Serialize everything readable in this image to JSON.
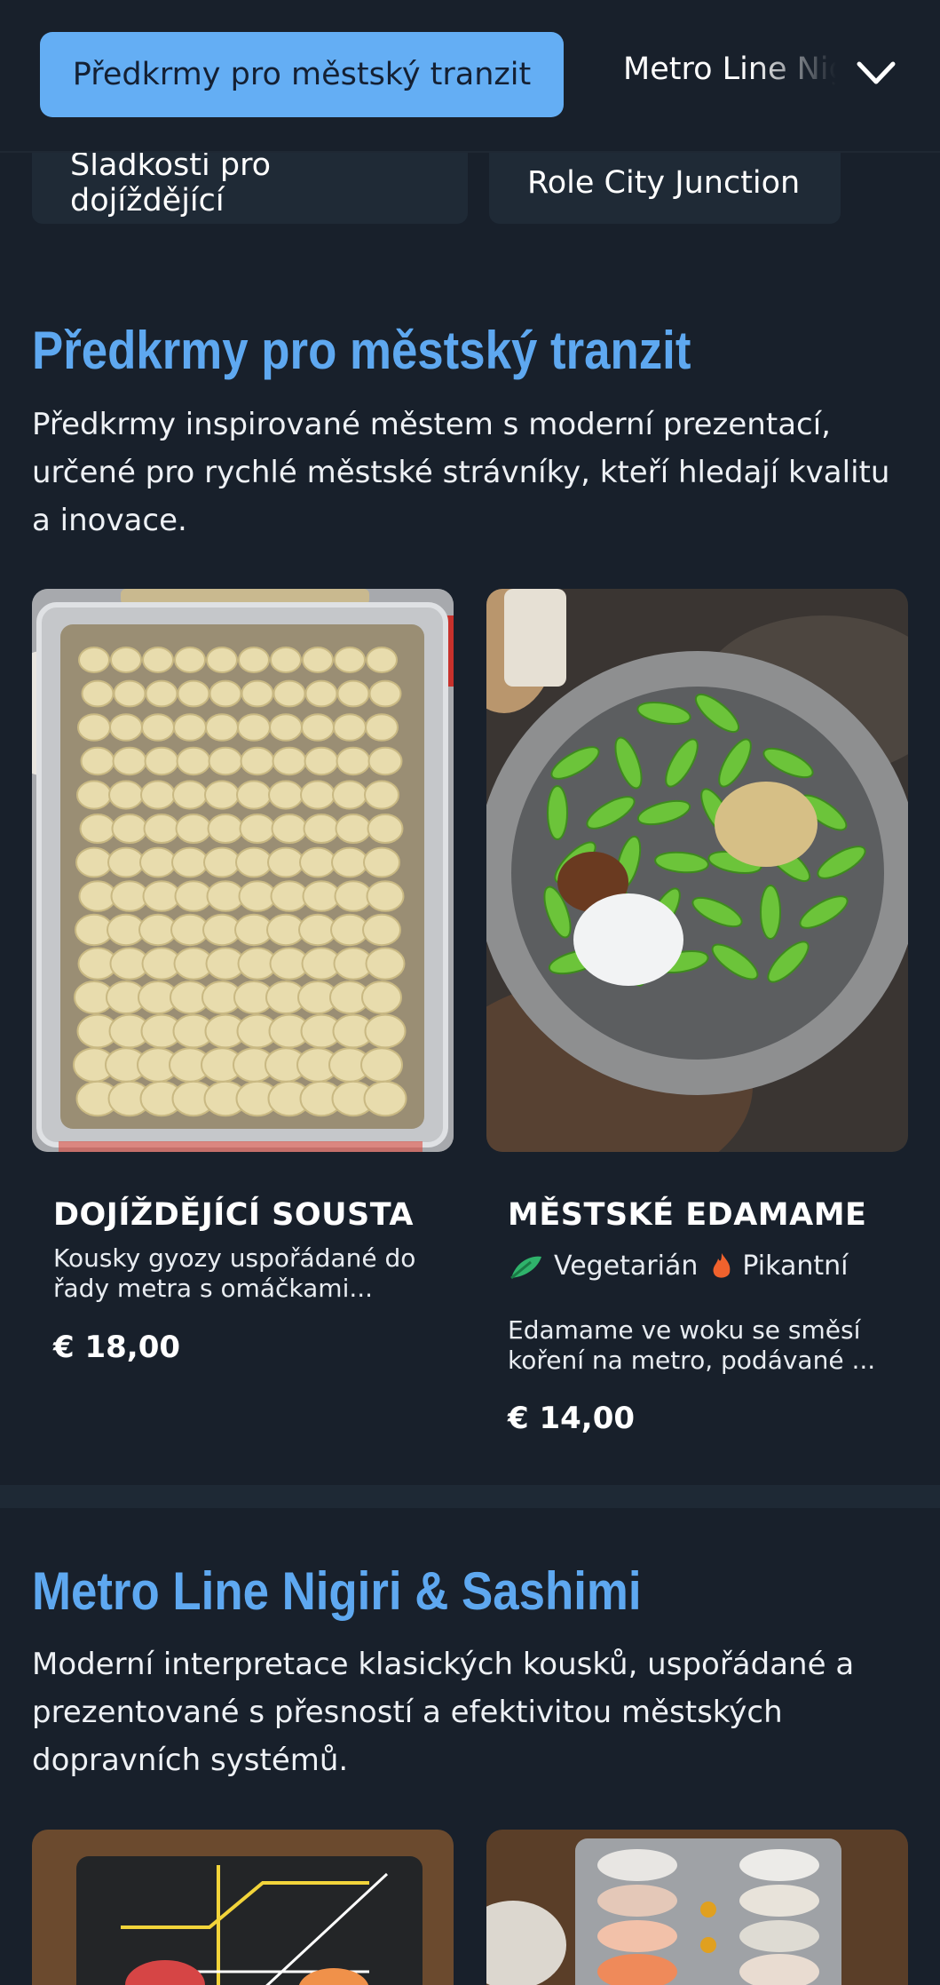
{
  "nav": {
    "active_tab": "Předkrmy pro městský tranzit",
    "next_tab": "Metro Line Nigiri & Sashimi",
    "chips": [
      "Sladkosti pro dojíždějící",
      "Role City Junction"
    ]
  },
  "sections": [
    {
      "title": "Předkrmy pro městský tranzit",
      "description": "Předkrmy inspirované městem s moderní prezentací, určené pro rychlé městské strávníky, kteří hledají kvalitu a inovace.",
      "items": [
        {
          "name": "DOJÍŽDĚJÍCÍ SOUSTA",
          "description": "Kousky gyozy uspořádané do řady metra s omáčkami...",
          "price": "€ 18,00",
          "image_icon": "gyoza-tray-photo"
        },
        {
          "name": "MĚSTSKÉ EDAMAME",
          "tags": [
            {
              "label": "Vegetarián",
              "icon": "vegetarian-icon",
              "color": "#2fb36b"
            },
            {
              "label": "Pikantní",
              "icon": "flame-icon",
              "color": "#f0622d"
            }
          ],
          "description": "Edamame ve woku se směsí koření na metro, podávané ...",
          "price": "€ 14,00",
          "image_icon": "edamame-bowl-photo"
        }
      ]
    },
    {
      "title": "Metro Line Nigiri & Sashimi",
      "description": "Moderní interpretace klasických kousků, uspořádané a prezentované s přesností a efektivitou městských dopravních systémů."
    }
  ],
  "colors": {
    "background": "#18202b",
    "accent": "#5ea8f0",
    "active_tab": "#64aef4"
  }
}
